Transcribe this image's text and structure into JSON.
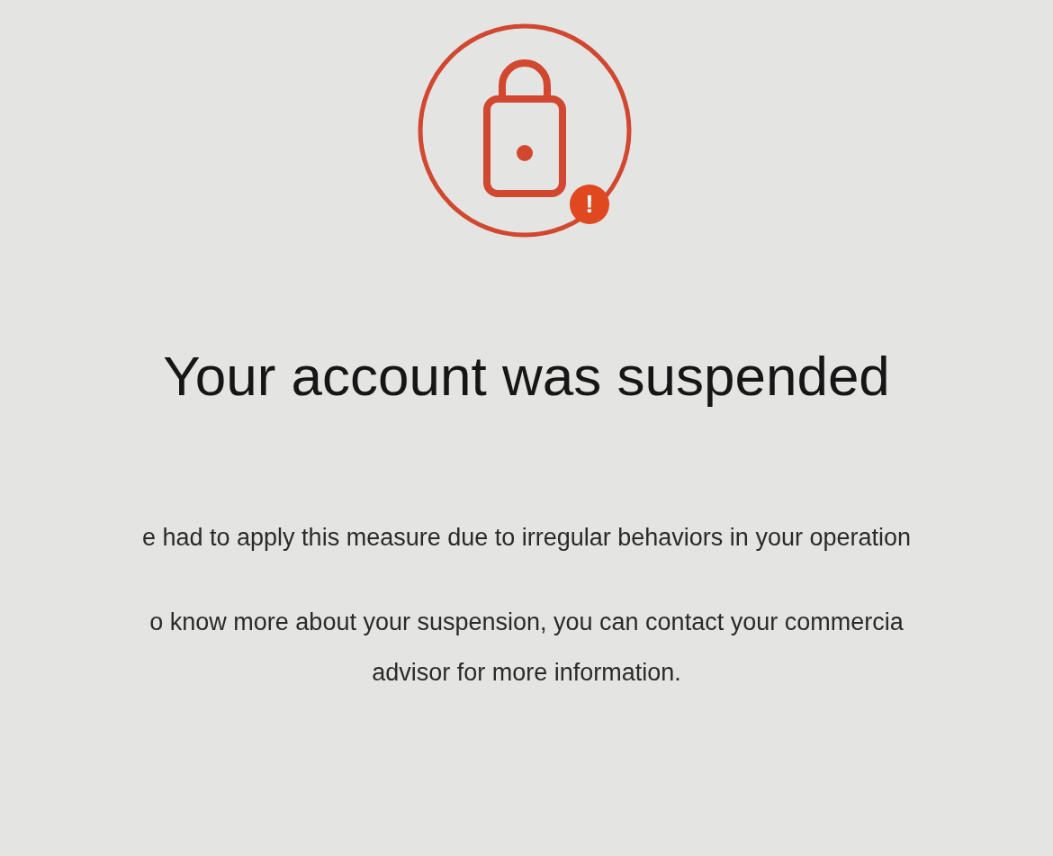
{
  "title": "Your account was suspended",
  "paragraphs": [
    "e had to apply this measure due to irregular behaviors in your operation",
    "o know more about your suspension, you can contact your commercia\nadvisor for more information."
  ],
  "alert_badge": {
    "text": "!"
  }
}
